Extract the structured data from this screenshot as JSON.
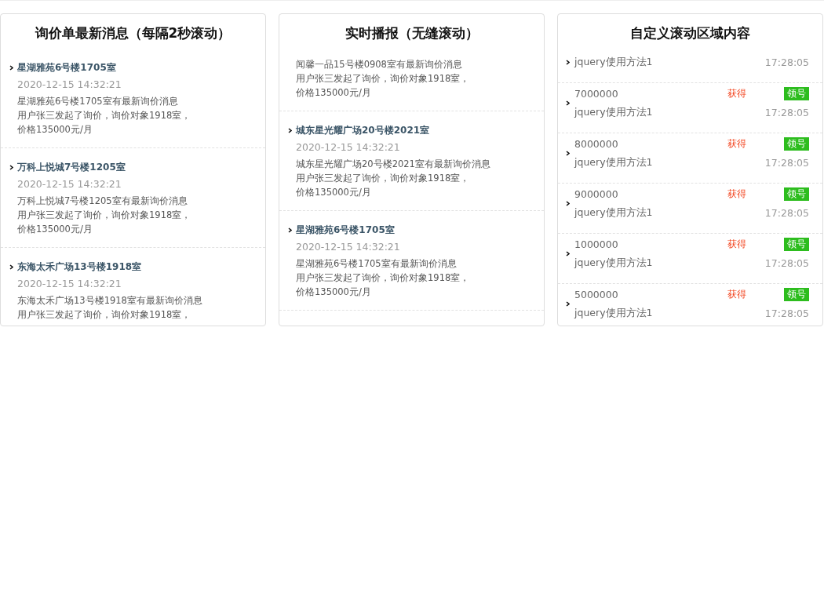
{
  "panels": [
    {
      "kind": "inquiry",
      "title": "询价单最新消息（每隔2秒滚动）",
      "items": [
        {
          "title": "星湖雅苑6号楼1705室",
          "date": "2020-12-15 14:32:21",
          "body": [
            "星湖雅苑6号楼1705室有最新询价消息",
            "用户张三发起了询价，询价对象1918室，",
            "价格135000元/月"
          ]
        },
        {
          "title": "万科上悦城7号楼1205室",
          "date": "2020-12-15 14:32:21",
          "body": [
            "万科上悦城7号楼1205室有最新询价消息",
            "用户张三发起了询价，询价对象1918室，",
            "价格135000元/月"
          ]
        },
        {
          "title": "东海太禾广场13号楼1918室",
          "date": "2020-12-15 14:32:21",
          "body": [
            "东海太禾广场13号楼1918室有最新询价消息",
            "用户张三发起了询价，询价对象1918室，"
          ]
        }
      ]
    },
    {
      "kind": "inquiry",
      "title": "实时播报（无缝滚动）",
      "items": [
        {
          "body": [
            "闻馨一品15号楼0908室有最新询价消息",
            "用户张三发起了询价，询价对象1918室，",
            "价格135000元/月"
          ]
        },
        {
          "title": "城东星光耀广场20号楼2021室",
          "date": "2020-12-15 14:32:21",
          "body": [
            "城东星光耀广场20号楼2021室有最新询价消息",
            "用户张三发起了询价，询价对象1918室，",
            "价格135000元/月"
          ]
        },
        {
          "title": "星湖雅苑6号楼1705室",
          "date": "2020-12-15 14:32:21",
          "body": [
            "星湖雅苑6号楼1705室有最新询价消息",
            "用户张三发起了询价，询价对象1918室，",
            "价格135000元/月"
          ]
        }
      ]
    },
    {
      "kind": "custom",
      "title": "自定义滚动区域内容",
      "items": [
        {
          "name": "jquery使用方法1",
          "time": "17:28:05"
        },
        {
          "amount": "7000000",
          "status": "获得",
          "badge": "领号",
          "name": "jquery使用方法1",
          "time": "17:28:05"
        },
        {
          "amount": "8000000",
          "status": "获得",
          "badge": "领号",
          "name": "jquery使用方法1",
          "time": "17:28:05"
        },
        {
          "amount": "9000000",
          "status": "获得",
          "badge": "领号",
          "name": "jquery使用方法1",
          "time": "17:28:05"
        },
        {
          "amount": "1000000",
          "status": "获得",
          "badge": "领号",
          "name": "jquery使用方法1",
          "time": "17:28:05"
        },
        {
          "amount": "5000000",
          "status": "获得",
          "badge": "领号",
          "name": "jquery使用方法1",
          "time": "17:28:05"
        }
      ]
    }
  ]
}
